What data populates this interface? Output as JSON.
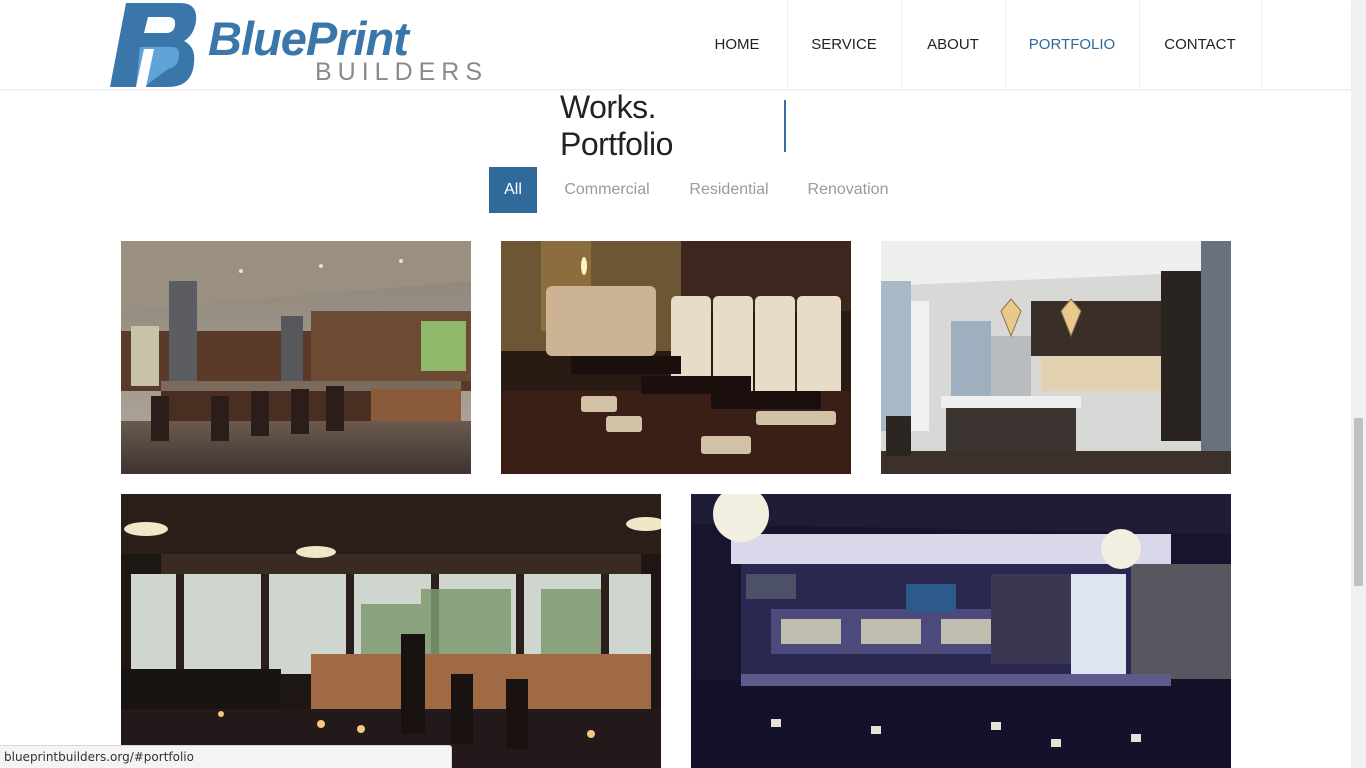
{
  "brand": {
    "name_main": "BluePrint",
    "name_sub": "BUILDERS",
    "primary_color": "#2f6a9b",
    "light_color": "#5fa4d6"
  },
  "nav": {
    "items": [
      {
        "label": "HOME"
      },
      {
        "label": "SERVICE"
      },
      {
        "label": "ABOUT"
      },
      {
        "label": "PORTFOLIO"
      },
      {
        "label": "CONTACT"
      }
    ],
    "active": "PORTFOLIO"
  },
  "section": {
    "title": "Works. Portfolio"
  },
  "filters": {
    "items": [
      {
        "label": "All"
      },
      {
        "label": "Commercial"
      },
      {
        "label": "Residential"
      },
      {
        "label": "Renovation"
      }
    ],
    "active": "All"
  },
  "gallery": {
    "items": [
      {
        "subject": "open kitchen with stone columns and bar seating"
      },
      {
        "subject": "restaurant booth seating with dark tables"
      },
      {
        "subject": "modern kitchen with pendant lights"
      },
      {
        "subject": "restaurant dining room with large windows"
      },
      {
        "subject": "bar with backlit shelves and wine wall"
      }
    ]
  },
  "status": {
    "url": "blueprintbuilders.org/#portfolio"
  }
}
